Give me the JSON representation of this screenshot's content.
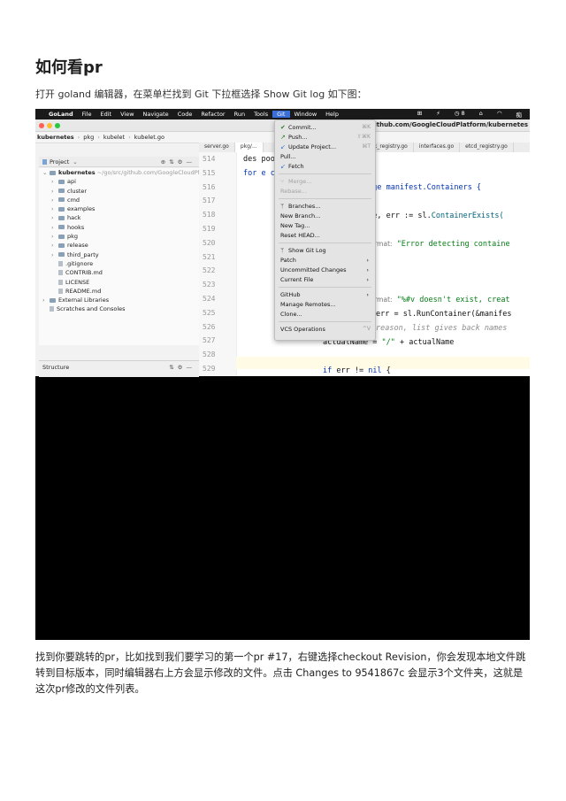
{
  "title": "如何看pr",
  "intro": "打开 goland 编辑器，在菜单栏找到 Git 下拉框选择 Show Git log 如下图：",
  "screenshot": {
    "macbar": {
      "apple": "",
      "items": [
        "GoLand",
        "File",
        "Edit",
        "View",
        "Navigate",
        "Code",
        "Refactor",
        "Run",
        "Tools",
        "Git",
        "Window",
        "Help"
      ],
      "right": [
        "⊞",
        "⚡",
        "◷ 8",
        "⌂",
        "◠",
        "痴"
      ]
    },
    "window_path": "/go/src/github.com/GoogleCloudPlatform/kubernetes",
    "breadcrumbs": [
      "kubernetes",
      "pkg",
      "kubelet",
      "kubelet.go"
    ],
    "tabs": [
      "server.go",
      "pkg/...",
      "task_registry.go",
      "interfaces.go",
      "etcd_registry.go"
    ],
    "project_label": "Project",
    "tree": [
      {
        "label": "kubernetes",
        "extra": "~/go/src/github.com/GoogleCloudPlatf",
        "kind": "folder",
        "indent": 0
      },
      {
        "label": "api",
        "kind": "folder",
        "indent": 1
      },
      {
        "label": "cluster",
        "kind": "folder",
        "indent": 1
      },
      {
        "label": "cmd",
        "kind": "folder",
        "indent": 1
      },
      {
        "label": "examples",
        "kind": "folder",
        "indent": 1
      },
      {
        "label": "hack",
        "kind": "folder",
        "indent": 1
      },
      {
        "label": "hooks",
        "kind": "folder",
        "indent": 1
      },
      {
        "label": "pkg",
        "kind": "folder",
        "indent": 1
      },
      {
        "label": "release",
        "kind": "folder",
        "indent": 1
      },
      {
        "label": "third_party",
        "kind": "folder",
        "indent": 1
      },
      {
        "label": ".gitignore",
        "kind": "file",
        "indent": 1
      },
      {
        "label": "CONTRIB.md",
        "kind": "file",
        "indent": 1
      },
      {
        "label": "LICENSE",
        "kind": "file",
        "indent": 1
      },
      {
        "label": "README.md",
        "kind": "file",
        "indent": 1
      },
      {
        "label": "External Libraries",
        "kind": "folder",
        "indent": 0
      },
      {
        "label": "Scratches and Consoles",
        "kind": "file",
        "indent": 0
      }
    ],
    "structure_label": "Structure",
    "line_numbers": [
      "514",
      "515",
      "516",
      "517",
      "518",
      "519",
      "520",
      "521",
      "522",
      "523",
      "524",
      "525",
      "526",
      "527",
      "528",
      "529"
    ],
    "code": {
      "l514": "des          pool{}",
      "l515a": "for",
      "l515b": "e config {",
      "l516": "ange manifest.Containers {",
      "l518a": "ame, err := sl.",
      "l518b": "ContainerExists(",
      "l520_hint": "format:",
      "l520_str": "\"Error detecting containe",
      "l524_hint": "format:",
      "l524_str": "\"%#v doesn't exist, creat",
      "l525": "err = sl.RunContainer(&manifes",
      "l526": "reason, list gives back names",
      "l527a": "actualName = ",
      "l527b": "\"/\"",
      "l527c": " + actualName",
      "l529a": "if",
      "l529b": " err != ",
      "l529c": "nil",
      "l529d": " {"
    },
    "git_menu": {
      "commit": "Commit...",
      "commit_sc": "⌘K",
      "push": "Push...",
      "push_sc": "⇧⌘K",
      "update": "Update Project...",
      "update_sc": "⌘T",
      "pull": "Pull...",
      "fetch": "Fetch",
      "merge": "Merge...",
      "rebase": "Rebase...",
      "branches": "Branches...",
      "new_branch": "New Branch...",
      "new_tag": "New Tag...",
      "reset_head": "Reset HEAD...",
      "show_git_log": "Show Git Log",
      "patch": "Patch",
      "uncommitted": "Uncommitted Changes",
      "current_file": "Current File",
      "github": "GitHub",
      "manage_remotes": "Manage Remotes...",
      "clone": "Clone...",
      "vcs_ops": "VCS Operations",
      "vcs_sc": "^V"
    }
  },
  "body": "找到你要跳转的pr，比如找到我们要学习的第一个pr #17，右键选择checkout Revision，你会发现本地文件跳转到目标版本，同时编辑器右上方会显示修改的文件。点击 Changes to 9541867c 会显示3个文件夹，这就是这次pr修改的文件列表。",
  "colors": {
    "accent": "#3a6fd8",
    "menu_bg": "#e4e4e4",
    "editor_bg": "#ffffff",
    "black_area": "#000000"
  }
}
